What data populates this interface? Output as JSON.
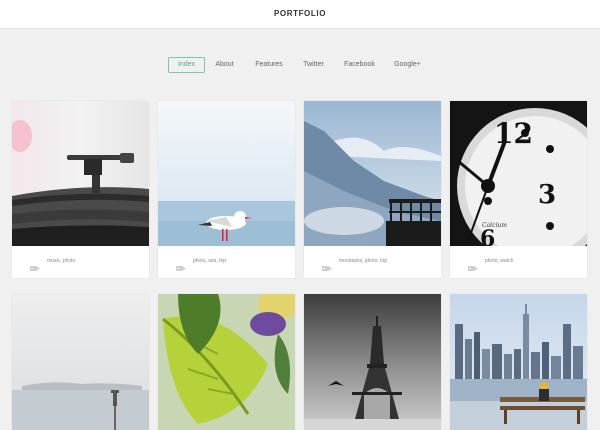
{
  "header": {
    "title": "PORTFOLIO"
  },
  "nav": {
    "items": [
      {
        "label": "Index",
        "active": true
      },
      {
        "label": "About"
      },
      {
        "label": "Features"
      },
      {
        "label": "Twitter"
      },
      {
        "label": "Facebook"
      },
      {
        "label": "Google+"
      }
    ]
  },
  "grid": {
    "items": [
      {
        "image": "turntable-photo",
        "tags": "music, photo"
      },
      {
        "image": "seagull-photo",
        "tags": "photo, sea, trip"
      },
      {
        "image": "mountains-photo",
        "tags": "mountains, photo, trip"
      },
      {
        "image": "clock-photo",
        "tags": "photo, watch"
      },
      {
        "image": "foggy-sea-photo"
      },
      {
        "image": "leaves-photo"
      },
      {
        "image": "eiffel-tower-photo"
      },
      {
        "image": "city-skyline-photo"
      }
    ]
  },
  "icons": {
    "tag": "tag-icon"
  },
  "colors": {
    "accent": "#4fae86",
    "background": "#f0f0f0"
  }
}
